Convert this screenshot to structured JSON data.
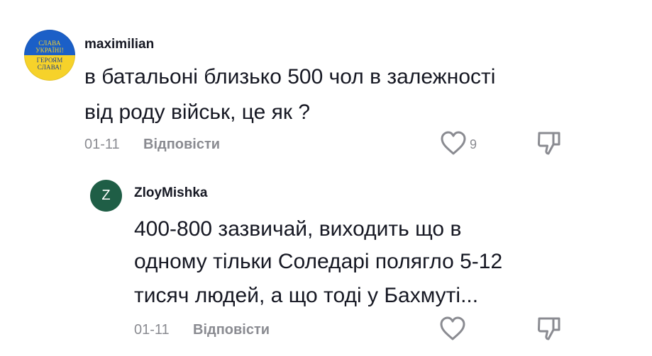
{
  "comments": [
    {
      "avatar": {
        "type": "image",
        "text_top": "СЛАВА УКРАЇНІ!",
        "text_bottom": "ГЕРОЯМ СЛАВА!",
        "colors": [
          "#1b5fc7",
          "#f6d22a"
        ]
      },
      "username": "maximilian",
      "text_lines": [
        "в батальоні близько 500 чол в залежності",
        "від роду військ, це як ?"
      ],
      "date": "01-11",
      "reply_label": "Відповісти",
      "likes": "9",
      "icons": {
        "like": "heart-outline-icon",
        "dislike": "thumbs-down-icon"
      }
    }
  ],
  "replies": [
    {
      "avatar": {
        "type": "letter",
        "letter": "Z",
        "color": "#1f5e46"
      },
      "username": "ZloyMishka",
      "text_lines": [
        "400-800 зазвичай, виходить що в",
        "одному тільки Соледарі полягло 5-12",
        "тисяч людей, а що тоді у Бахмуті..."
      ],
      "date": "01-11",
      "reply_label": "Відповісти",
      "icons": {
        "like": "heart-outline-icon",
        "dislike": "thumbs-down-icon"
      }
    }
  ]
}
